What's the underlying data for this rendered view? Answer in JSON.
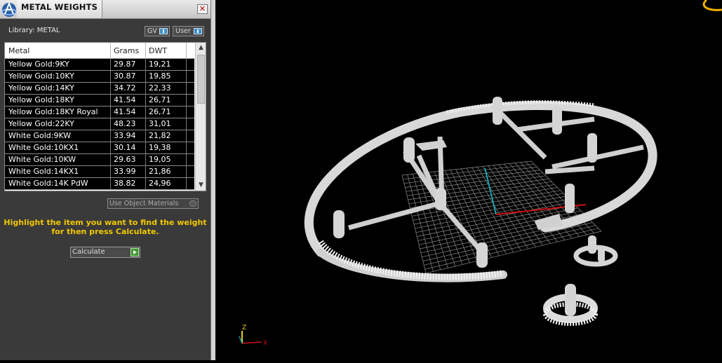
{
  "window": {
    "title": "METAL WEIGHTS",
    "close_glyph": "✕"
  },
  "library": {
    "label": "Library: METAL",
    "buttons": [
      {
        "label": "GV",
        "icon": "toggle-indicator-icon"
      },
      {
        "label": "User",
        "icon": "toggle-indicator-icon"
      }
    ]
  },
  "table": {
    "headers": [
      "Metal",
      "Grams",
      "DWT"
    ],
    "rows": [
      [
        "Yellow Gold:9KY",
        "29.87",
        "19,21"
      ],
      [
        "Yellow Gold:10KY",
        "30.87",
        "19,85"
      ],
      [
        "Yellow Gold:14KY",
        "34.72",
        "22,33"
      ],
      [
        "Yellow Gold:18KY",
        "41.54",
        "26,71"
      ],
      [
        "Yellow Gold:18KY Royal",
        "41.54",
        "26,71"
      ],
      [
        "Yellow Gold:22KY",
        "48.23",
        "31,01"
      ],
      [
        "White Gold:9KW",
        "33.94",
        "21,82"
      ],
      [
        "White Gold:10KX1",
        "30.14",
        "19,38"
      ],
      [
        "White Gold:10KW",
        "29.63",
        "19,05"
      ],
      [
        "White Gold:14KX1",
        "33.99",
        "21,86"
      ],
      [
        "White Gold:14K PdW",
        "38.82",
        "24,96"
      ]
    ],
    "scroll_up_glyph": "▲",
    "scroll_down_glyph": "▼"
  },
  "options": {
    "use_object_materials": "Use Object Materials",
    "checked": false
  },
  "instructions": {
    "line1": "Highlight the item you want to find the weight",
    "line2": "for then press Calculate."
  },
  "calculate": {
    "label": "Calculate",
    "icon": "play-arrow-icon"
  },
  "viewport": {
    "axis_z": "Z",
    "axis_x": "X",
    "axis_colors": {
      "x": "#d01010",
      "y": "#18a0b0",
      "z": "#e0d020"
    },
    "grid_color": "#8a8a8a",
    "model_color": "#cfcfcf",
    "icons": [
      "gumball-corner-icon",
      "axis-triad-icon"
    ]
  }
}
